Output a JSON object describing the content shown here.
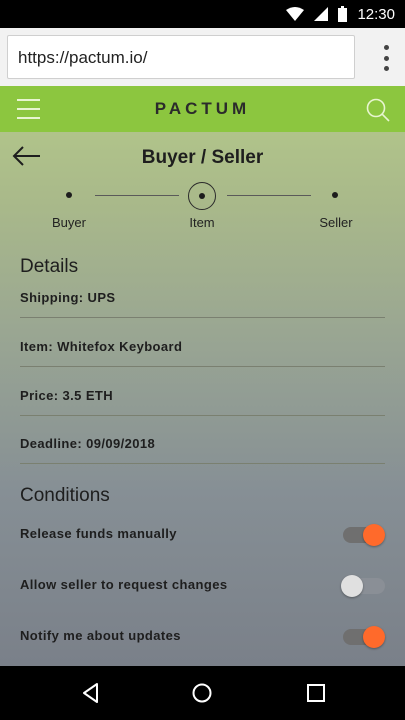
{
  "status_bar": {
    "time": "12:30",
    "icons": [
      "wifi-icon",
      "signal-icon",
      "battery-icon"
    ]
  },
  "browser": {
    "url": "https://pactum.io/",
    "menu_icon": "kebab-menu-icon"
  },
  "header": {
    "brand": "PACTUM",
    "accent_color": "#8cc63f",
    "icons": [
      "hamburger-menu-icon",
      "search-icon"
    ]
  },
  "page": {
    "title": "Buyer / Seller",
    "back_icon": "arrow-left-icon"
  },
  "stepper": {
    "steps": [
      {
        "label": "Buyer",
        "state": "inactive"
      },
      {
        "label": "Item",
        "state": "active"
      },
      {
        "label": "Seller",
        "state": "inactive"
      }
    ]
  },
  "details": {
    "title": "Details",
    "rows": [
      {
        "label": "Shipping: UPS"
      },
      {
        "label": "Item: Whitefox Keyboard"
      },
      {
        "label": "Price: 3.5 ETH"
      },
      {
        "label": "Deadline: 09/09/2018"
      }
    ]
  },
  "conditions": {
    "title": "Conditions",
    "toggle_on_color": "#ff6a2b",
    "items": [
      {
        "label": "Release funds manually",
        "on": true
      },
      {
        "label": "Allow seller to request changes",
        "on": false
      },
      {
        "label": "Notify me about updates",
        "on": true
      }
    ]
  },
  "nav_bar": {
    "icons": [
      "back-triangle-icon",
      "home-circle-icon",
      "recents-square-icon"
    ]
  }
}
